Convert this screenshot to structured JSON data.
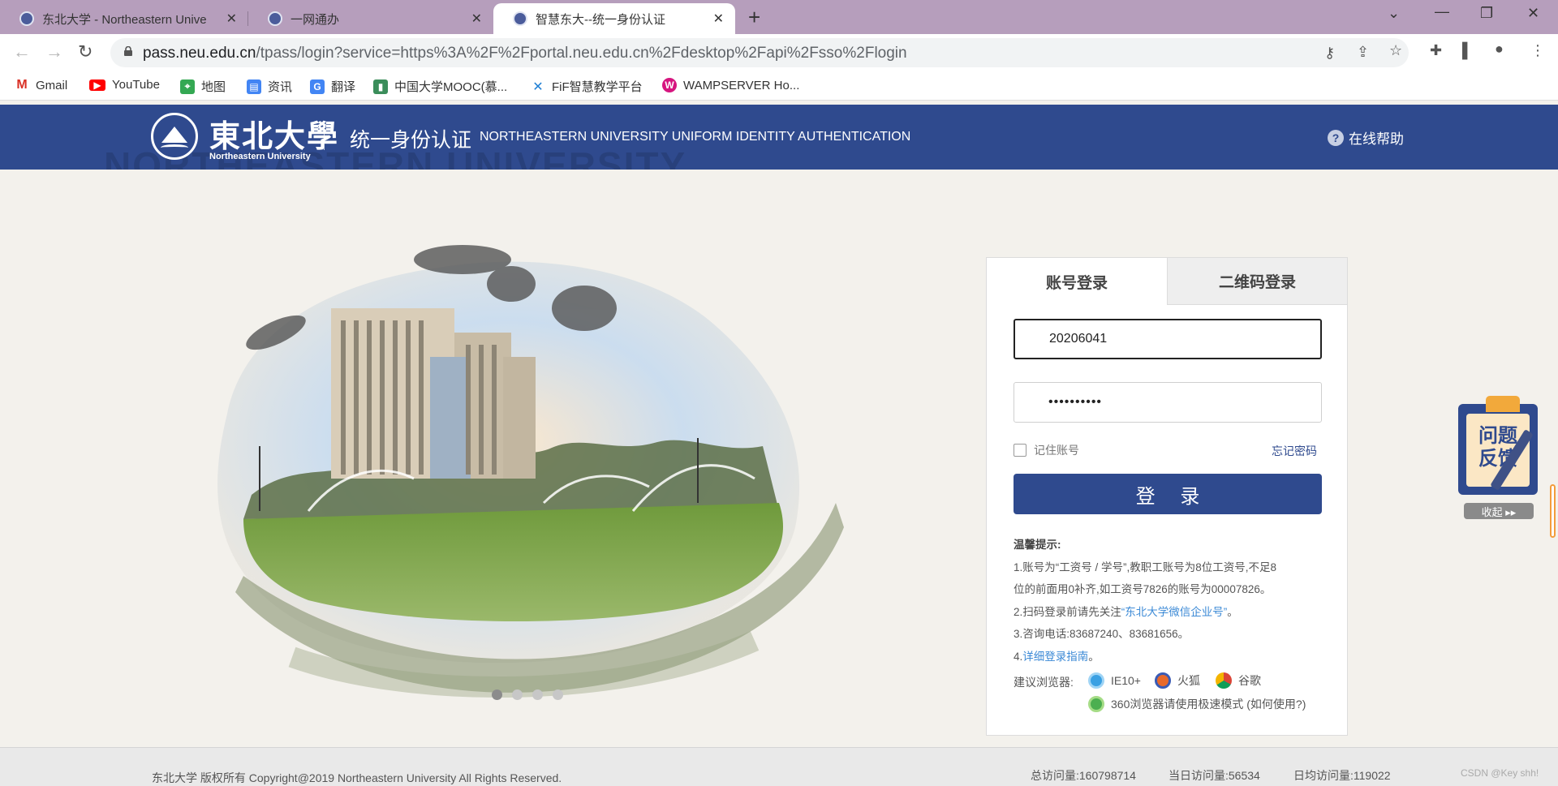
{
  "browser": {
    "tabs": [
      {
        "title": "东北大学 - Northeastern Unive",
        "active": false
      },
      {
        "title": "一网通办",
        "active": false
      },
      {
        "title": "智慧东大--统一身份认证",
        "active": true
      }
    ],
    "url_host": "pass.neu.edu.cn",
    "url_path": "/tpass/login?service=https%3A%2F%2Fportal.neu.edu.cn%2Fdesktop%2Fapi%2Fsso%2Flogin",
    "bookmarks": [
      {
        "label": "Gmail",
        "icon": "gmail-icon",
        "color": "#d93025"
      },
      {
        "label": "YouTube",
        "icon": "youtube-icon",
        "color": "#ff0000"
      },
      {
        "label": "地图",
        "icon": "maps-icon",
        "color": "#34a853"
      },
      {
        "label": "资讯",
        "icon": "news-icon",
        "color": "#4285f4"
      },
      {
        "label": "翻译",
        "icon": "translate-icon",
        "color": "#4285f4"
      },
      {
        "label": "中国大学MOOC(慕...",
        "icon": "mooc-icon",
        "color": "#3a8d5a"
      },
      {
        "label": "FiF智慧教学平台",
        "icon": "fif-icon",
        "color": "#1f7fd4"
      },
      {
        "label": "WAMPSERVER Ho...",
        "icon": "wamp-icon",
        "color": "#d6157f"
      }
    ]
  },
  "header": {
    "logo_cn": "東北大學",
    "logo_en": "Northeastern University",
    "title": "统一身份认证",
    "title_en": "NORTHEASTERN UNIVERSITY UNIFORM IDENTITY AUTHENTICATION",
    "help": "在线帮助",
    "watermark": "NORTHEASTERN UNIVERSITY"
  },
  "hero": {
    "slides": 4,
    "active_slide": 1
  },
  "login": {
    "tab_account": "账号登录",
    "tab_qr": "二维码登录",
    "username": "20206041",
    "password_mask": "••••••••••",
    "remember": "记住账号",
    "forgot": "忘记密码",
    "submit": "登 录",
    "tips_title": "温馨提示:",
    "tip1a": "1.账号为“工资号 / 学号”,教职工账号为8位工资号,不足8",
    "tip1b": "位的前面用0补齐,如工资号7826的账号为00007826。",
    "tip2_pre": "2.扫码登录前请先关注",
    "tip2_link": "“东北大学微信企业号”",
    "tip2_post": "。",
    "tip3": "3.咨询电话:83687240、83681656。",
    "tip4_pre": "4.",
    "tip4_link": "详细登录指南",
    "tip4_post": "。",
    "browsers_label": "建议浏览器:",
    "browser_ie": "IE10+",
    "browser_ff": "火狐",
    "browser_chrome": "谷歌",
    "browser_360": "360浏览器请使用极速模式 (如何使用?)"
  },
  "feedback": {
    "line1": "问题",
    "line2": "反馈",
    "collapse": "收起 ▸▸"
  },
  "footer": {
    "copyright": "东北大学 版权所有 Copyright@2019 Northeastern University All Rights Reserved.",
    "total": "总访问量:160798714",
    "today": "当日访问量:56534",
    "daily_avg": "日均访问量:119022",
    "credit": "CSDN @Key shh!"
  },
  "colors": {
    "brand": "#2f4a8e",
    "tabbar": "#b69ebc",
    "link": "#3c8ad6"
  }
}
